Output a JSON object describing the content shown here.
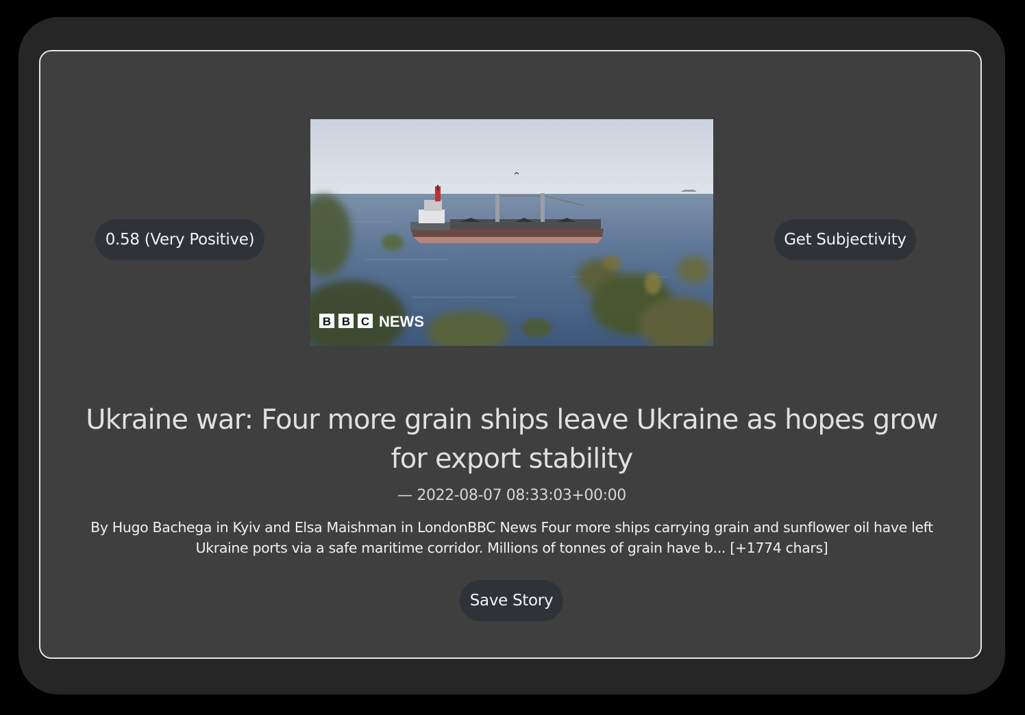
{
  "story": {
    "sentiment_label": "0.58 (Very Positive)",
    "subjectivity_button": "Get Subjectivity",
    "image": {
      "logo_letters": [
        "B",
        "B",
        "C"
      ],
      "logo_word": "NEWS"
    },
    "headline": "Ukraine war: Four more grain ships leave Ukraine as hopes grow for export stability",
    "dateline": "— 2022-08-07 08:33:03+00:00",
    "summary": "By Hugo Bachega in Kyiv and Elsa Maishman in LondonBBC News Four more ships carrying grain and sunflower oil have left Ukraine ports via a safe maritime corridor. Millions of tonnes of grain have b... [+1774 chars]",
    "save_button": "Save Story"
  },
  "colors": {
    "page_background": "#000000",
    "frame_background": "#262626",
    "card_background": "#3f3f3f",
    "card_border": "#e6e6e6",
    "pill_background": "#2f3337",
    "text": "#e0e0e0"
  }
}
